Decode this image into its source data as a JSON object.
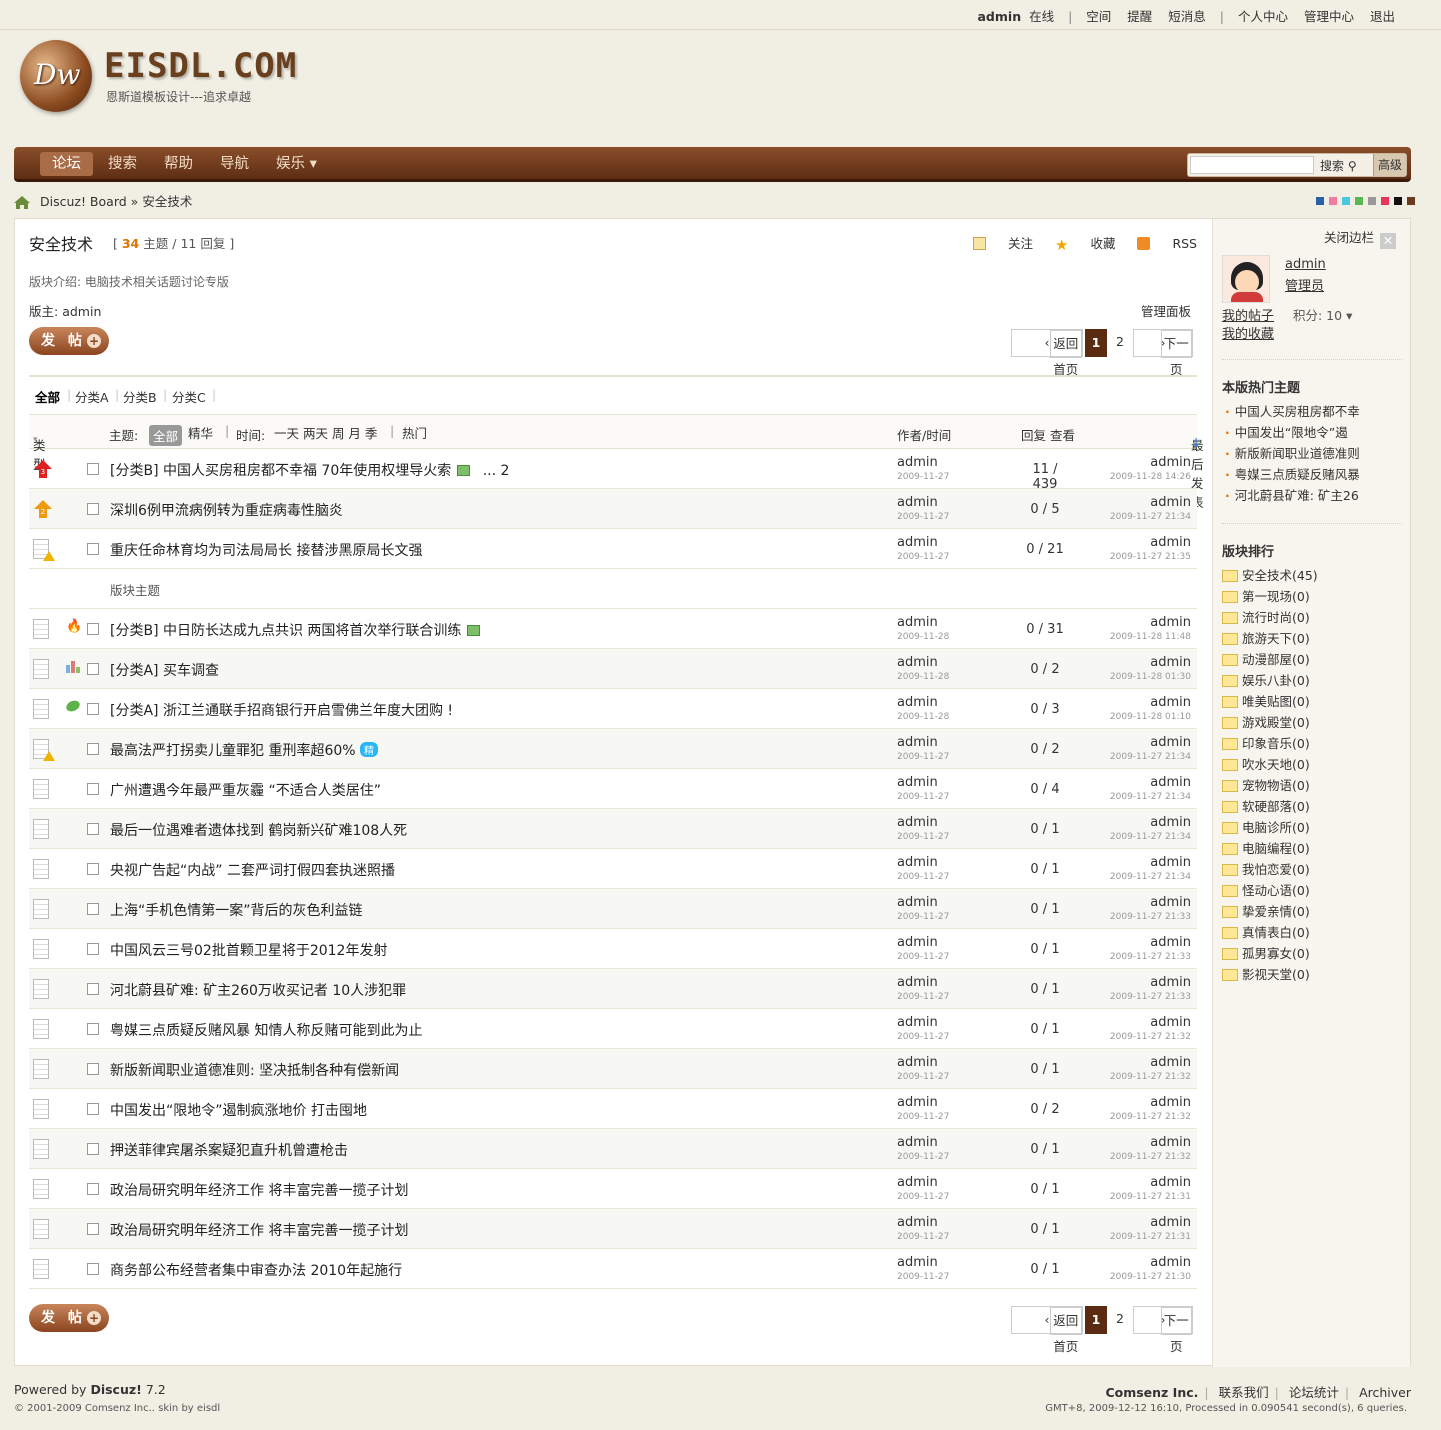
{
  "topbar": {
    "user": "admin",
    "status": "在线",
    "links": [
      "空间",
      "提醒",
      "短消息"
    ],
    "links2": [
      "个人中心",
      "管理中心",
      "退出"
    ]
  },
  "header": {
    "logo_text": "Dw",
    "site_name": "EISDL.COM",
    "slogan": "恩斯道模板设计---追求卓越"
  },
  "nav": {
    "items": [
      "论坛",
      "搜索",
      "帮助",
      "导航",
      "娱乐 ▾"
    ],
    "search_button": "搜索",
    "advanced": "高级"
  },
  "breadcrumb": {
    "home": "Discuz! Board",
    "sep": "»",
    "current": "安全技术"
  },
  "swatch_colors": [
    "#2b5fa8",
    "#f07ca0",
    "#4ac8e0",
    "#59b94e",
    "#999999",
    "#e8365d",
    "#111111",
    "#6b3b1f"
  ],
  "forum": {
    "title": "安全技术",
    "threads": "34",
    "threads_label": "主题",
    "replies": "11",
    "replies_label": "回复",
    "follow": "关注",
    "favorite": "收藏",
    "rss": "RSS",
    "desc": "版块介绍: 电脑技术相关话题讨论专版",
    "mod_label": "版主:",
    "mod": "admin",
    "manage": "管理面板",
    "post_button": "发 帖",
    "pager": {
      "back": "返回首页",
      "p1": "1",
      "p2": "2",
      "next": "下一页"
    }
  },
  "types": {
    "all": "全部",
    "items": [
      "分类A",
      "分类B",
      "分类C"
    ]
  },
  "thead": {
    "type": "类型",
    "subject_label": "主题:",
    "all": "全部",
    "digest": "精华",
    "time_label": "时间:",
    "times": "一天 两天 周 月 季",
    "hot": "热门",
    "author": "作者/时间",
    "replies_views": "回复 查看",
    "lastpost": "最后发表"
  },
  "section_label": "版块主题",
  "threads_top": [
    {
      "subject": "[分类B] 中国人买房租房都不幸福  70年使用权埋导火索",
      "pages": "... 2",
      "date": "2009-11-27",
      "rv": "11 / 439",
      "last_date": "2009-11-28 14:26"
    },
    {
      "subject": "深圳6例甲流病例转为重症病毒性脑炎",
      "pages": "",
      "date": "2009-11-27",
      "rv": "0 / 5",
      "last_date": "2009-11-27 21:34"
    },
    {
      "subject": "重庆任命林育均为司法局局长  接替涉黑原局长文强",
      "pages": "",
      "date": "2009-11-27",
      "rv": "0 / 21",
      "last_date": "2009-11-27 21:35"
    }
  ],
  "threads": [
    {
      "subject": "[分类B] 中日防长达成九点共识  两国将首次举行联合训练",
      "date": "2009-11-28",
      "rv": "0 / 31",
      "last_date": "2009-11-28 11:48"
    },
    {
      "subject": "[分类A] 买车调查",
      "date": "2009-11-28",
      "rv": "0 / 2",
      "last_date": "2009-11-28 01:30"
    },
    {
      "subject": "[分类A] 浙江兰通联手招商银行开启雪佛兰年度大团购  !",
      "date": "2009-11-28",
      "rv": "0 / 3",
      "last_date": "2009-11-28 01:10"
    },
    {
      "subject": "最高法严打拐卖儿童罪犯  重刑率超60%",
      "badge": "精",
      "date": "2009-11-27",
      "rv": "0 / 2",
      "last_date": "2009-11-27 21:34"
    },
    {
      "subject": "广州遭遇今年最严重灰霾  “不适合人类居住”",
      "date": "2009-11-27",
      "rv": "0 / 4",
      "last_date": "2009-11-27 21:34"
    },
    {
      "subject": "最后一位遇难者遗体找到  鹤岗新兴矿难108人死",
      "date": "2009-11-27",
      "rv": "0 / 1",
      "last_date": "2009-11-27 21:34"
    },
    {
      "subject": "央视广告起“内战”  二套严词打假四套执迷照播",
      "date": "2009-11-27",
      "rv": "0 / 1",
      "last_date": "2009-11-27 21:34"
    },
    {
      "subject": "上海“手机色情第一案”背后的灰色利益链",
      "date": "2009-11-27",
      "rv": "0 / 1",
      "last_date": "2009-11-27 21:33"
    },
    {
      "subject": "中国风云三号02批首颗卫星将于2012年发射",
      "date": "2009-11-27",
      "rv": "0 / 1",
      "last_date": "2009-11-27 21:33"
    },
    {
      "subject": "河北蔚县矿难: 矿主260万收买记者  10人涉犯罪",
      "date": "2009-11-27",
      "rv": "0 / 1",
      "last_date": "2009-11-27 21:33"
    },
    {
      "subject": "粤媒三点质疑反赌风暴  知情人称反赌可能到此为止",
      "date": "2009-11-27",
      "rv": "0 / 1",
      "last_date": "2009-11-27 21:32"
    },
    {
      "subject": "新版新闻职业道德准则: 坚决抵制各种有偿新闻",
      "date": "2009-11-27",
      "rv": "0 / 1",
      "last_date": "2009-11-27 21:32"
    },
    {
      "subject": "中国发出“限地令”遏制疯涨地价  打击囤地",
      "date": "2009-11-27",
      "rv": "0 / 2",
      "last_date": "2009-11-27 21:32"
    },
    {
      "subject": "押送菲律宾屠杀案疑犯直升机曾遭枪击",
      "date": "2009-11-27",
      "rv": "0 / 1",
      "last_date": "2009-11-27 21:32"
    },
    {
      "subject": "政治局研究明年经济工作  将丰富完善一揽子计划",
      "date": "2009-11-27",
      "rv": "0 / 1",
      "last_date": "2009-11-27 21:31"
    },
    {
      "subject": "政治局研究明年经济工作  将丰富完善一揽子计划",
      "date": "2009-11-27",
      "rv": "0 / 1",
      "last_date": "2009-11-27 21:31"
    },
    {
      "subject": "商务部公布经营者集中审查办法  2010年起施行",
      "date": "2009-11-27",
      "rv": "0 / 1",
      "last_date": "2009-11-27 21:30"
    }
  ],
  "author": "admin",
  "sidebar": {
    "close": "关闭边栏",
    "user": "admin",
    "role": "管理员",
    "my_posts": "我的帖子",
    "my_favs": "我的收藏",
    "credits": "积分: 10 ▾",
    "hot_title": "本版热门主题",
    "hot": [
      "中国人买房租房都不幸",
      "中国发出“限地令”遏",
      "新版新闻职业道德准则",
      "粤媒三点质疑反赌风暴",
      "河北蔚县矿难: 矿主26"
    ],
    "rank_title": "版块排行",
    "forums": [
      "安全技术(45)",
      "第一现场(0)",
      "流行时尚(0)",
      "旅游天下(0)",
      "动漫部屋(0)",
      "娱乐八卦(0)",
      "唯美贴图(0)",
      "游戏殿堂(0)",
      "印象音乐(0)",
      "吹水天地(0)",
      "宠物物语(0)",
      "软硬部落(0)",
      "电脑诊所(0)",
      "电脑编程(0)",
      "我怕恋爱(0)",
      "怪动心语(0)",
      "挚爱亲情(0)",
      "真情表白(0)",
      "孤男寡女(0)",
      "影视天堂(0)"
    ]
  },
  "footer": {
    "powered": "Powered by",
    "brand": "Discuz!",
    "version": "7.2",
    "copyright": "© 2001-2009 Comsenz Inc..   skin by eisdl",
    "company": "Comsenz Inc.",
    "links": [
      "联系我们",
      "论坛统计",
      "Archiver"
    ],
    "stats": "GMT+8, 2009-12-12 16:10, Processed in 0.090541 second(s), 6 queries."
  }
}
